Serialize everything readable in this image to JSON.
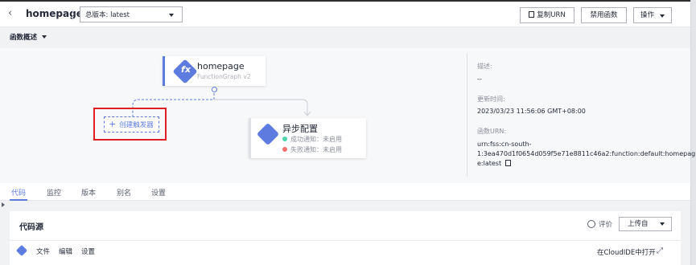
{
  "header": {
    "back_icon": "chevron-left-icon",
    "function_name": "homepage",
    "version_select": "总版本: latest",
    "copy_urn": "复制URN",
    "disable_function": "禁用函数",
    "operations": "操作"
  },
  "overview": {
    "title": "函数概述",
    "function_node": {
      "name": "homepage",
      "subtitle": "FunctionGraph v2"
    },
    "create_trigger": "创建触发器",
    "async_node": {
      "title": "异步配置",
      "success": "成功通知：未启用",
      "failure": "失败通知：未启用"
    },
    "info": {
      "desc_label": "描述:",
      "desc_value": "--",
      "updated_label": "更新时间:",
      "updated_value": "2023/03/23 11:56:06 GMT+08:00",
      "urn_label": "函数URN:",
      "urn_line1": "urn:fss:cn-south-",
      "urn_line2": "1:3ea470d1f0654d059f5e71e8811c46a2:function:default:homepag",
      "urn_line3": "e:latest"
    }
  },
  "tabs": [
    {
      "label": "代码",
      "active": true
    },
    {
      "label": "监控",
      "active": false
    },
    {
      "label": "版本",
      "active": false
    },
    {
      "label": "别名",
      "active": false
    },
    {
      "label": "设置",
      "active": false
    }
  ],
  "code_panel": {
    "title": "代码源",
    "rate": "评价",
    "upload": "上传自",
    "menu": [
      "文件",
      "编辑",
      "设置"
    ],
    "open_in_ide": "在CloudIDE中打开"
  },
  "colors": {
    "accent": "#5e7ce0",
    "success": "#50d4ab",
    "failure": "#f66f6a",
    "highlight": "#e02020"
  }
}
